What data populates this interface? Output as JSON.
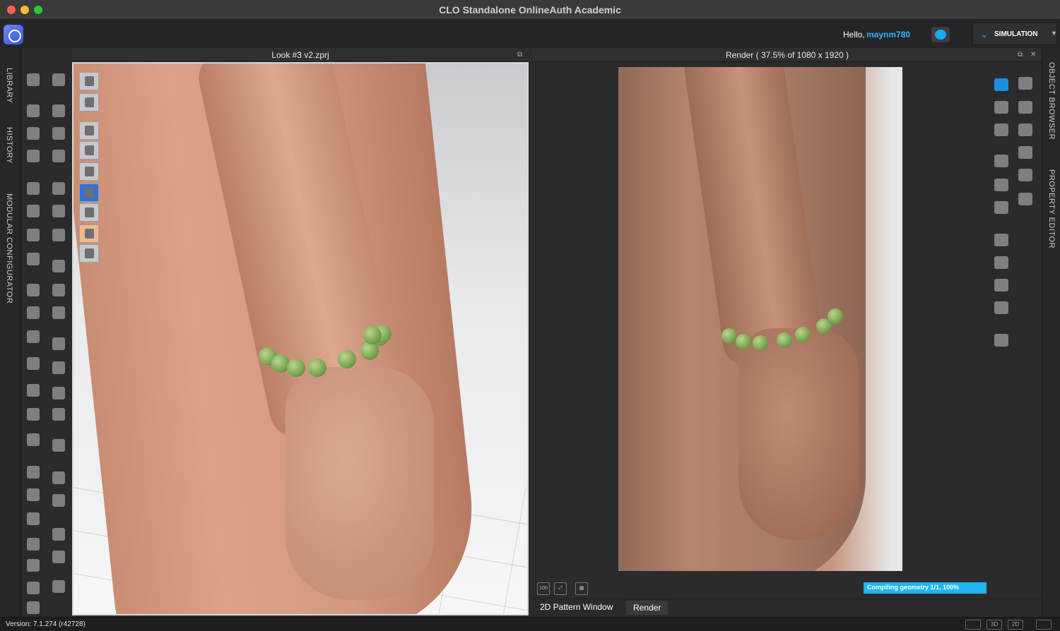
{
  "window": {
    "title": "CLO Standalone OnlineAuth Academic"
  },
  "header": {
    "greeting": "Hello,",
    "username": "maynm780",
    "mode_label": "SIMULATION",
    "mode_icon": "chevron-double-down-icon",
    "accent": "#1ba1ff"
  },
  "left_dock": {
    "tabs": [
      "LIBRARY",
      "HISTORY",
      "MODULAR CONFIGURATOR"
    ]
  },
  "right_dock": {
    "tabs": [
      "OBJECT BROWSER",
      "PROPERTY EDITOR"
    ]
  },
  "panes": {
    "viewport_3d": {
      "title": "Look #3 v2.zprj"
    },
    "render": {
      "title": "Render ( 37.5% of 1080 x 1920 )"
    }
  },
  "render_footer": {
    "progress_label": "Compiling geometry 1/1, 100%",
    "progress_percent": 100,
    "icon_100": "100",
    "tabs": [
      "2D Pattern Window",
      "Render"
    ],
    "active_tab": "Render"
  },
  "status_bar": {
    "version": "Version: 7.1.274 (r42728)",
    "view_buttons": [
      "",
      "3D",
      "2D",
      ""
    ]
  }
}
